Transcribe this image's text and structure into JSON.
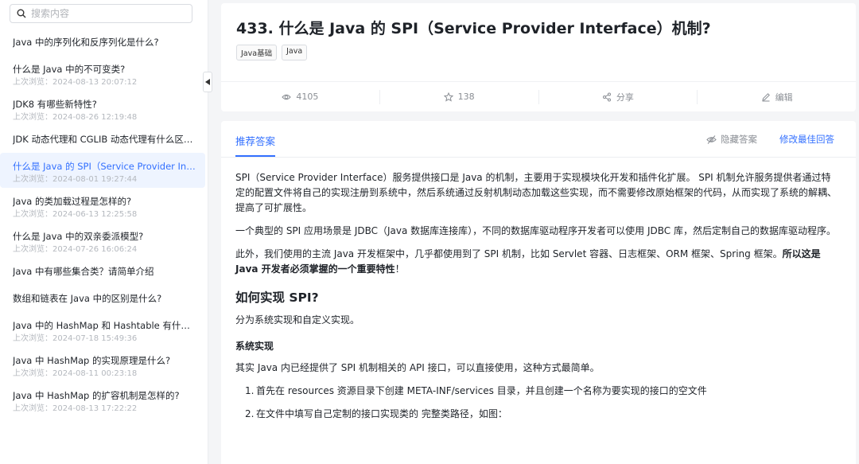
{
  "search": {
    "placeholder": "搜索内容"
  },
  "questions": [
    {
      "title": "Java 中的序列化和反序列化是什么?",
      "time": ""
    },
    {
      "title": "什么是 Java 中的不可变类?",
      "time": "上次浏览：2024-08-13 20:07:12"
    },
    {
      "title": "JDK8 有哪些新特性?",
      "time": "上次浏览：2024-08-26 12:19:48"
    },
    {
      "title": "JDK 动态代理和 CGLIB 动态代理有什么区别?",
      "time": ""
    },
    {
      "title": "什么是 Java 的 SPI（Service Provider Interfa...",
      "time": "上次浏览：2024-08-01 19:27:44",
      "active": true
    },
    {
      "title": "Java 的类加载过程是怎样的?",
      "time": "上次浏览：2024-06-13 12:25:58"
    },
    {
      "title": "什么是 Java 中的双亲委派模型?",
      "time": "上次浏览：2024-07-26 16:06:24"
    },
    {
      "title": "Java 中有哪些集合类？请简单介绍",
      "time": ""
    },
    {
      "title": "数组和链表在 Java 中的区别是什么?",
      "time": ""
    },
    {
      "title": "Java 中的 HashMap 和 Hashtable 有什么区...",
      "time": "上次浏览：2024-07-18 15:49:36"
    },
    {
      "title": "Java 中 HashMap 的实现原理是什么?",
      "time": "上次浏览：2024-08-11 00:23:18"
    },
    {
      "title": "Java 中 HashMap 的扩容机制是怎样的?",
      "time": "上次浏览：2024-08-13 17:22:22"
    }
  ],
  "header": {
    "title": "433. 什么是 Java 的 SPI（Service Provider Interface）机制?",
    "tags": [
      "Java基础",
      "Java"
    ],
    "views": "4105",
    "stars": "138",
    "share": "分享",
    "edit": "编辑"
  },
  "answer": {
    "tab": "推荐答案",
    "hide": "隐藏答案",
    "edit_best": "修改最佳回答",
    "p1": "SPI（Service Provider Interface）服务提供接口是 Java 的机制，主要用于实现模块化开发和插件化扩展。 SPI 机制允许服务提供者通过特定的配置文件将自己的实现注册到系统中，然后系统通过反射机制动态加载这些实现，而不需要修改原始框架的代码，从而实现了系统的解耦、提高了可扩展性。",
    "p2": "一个典型的 SPI 应用场景是 JDBC（Java 数据库连接库），不同的数据库驱动程序开发者可以使用 JDBC 库，然后定制自己的数据库驱动程序。",
    "p3_a": "此外，我们使用的主流 Java 开发框架中，几乎都使用到了 SPI 机制，比如 Servlet 容器、日志框架、ORM 框架、Spring 框架。",
    "p3_b": "所以这是 Java 开发者必须掌握的一个重要特性",
    "p3_c": "！",
    "h2": "如何实现 SPI?",
    "p4": "分为系统实现和自定义实现。",
    "h3": "系统实现",
    "p5": "其实 Java 内已经提供了 SPI 机制相关的 API 接口，可以直接使用，这种方式最简单。",
    "steps": [
      {
        "num": "1.",
        "text": "首先在 resources 资源目录下创建 META-INF/services 目录，并且创建一个名称为要实现的接口的空文件"
      },
      {
        "num": "2.",
        "text": "在文件中填写自己定制的接口实现类的 完整类路径，如图："
      }
    ]
  }
}
